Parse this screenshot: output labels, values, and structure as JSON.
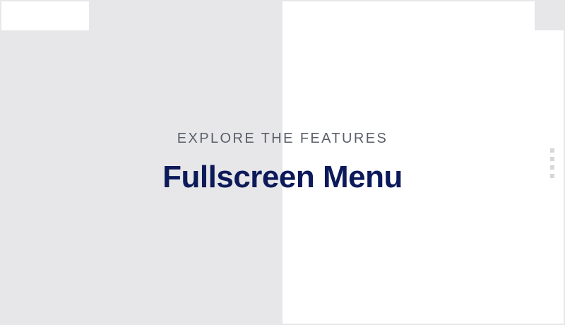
{
  "hero": {
    "eyebrow": "EXPLORE THE FEATURES",
    "headline": "Fullscreen Menu"
  },
  "pager": {
    "icon": "vertical-dots-icon",
    "dot_count": 4
  },
  "colors": {
    "left_panel": "#e7e7e9",
    "right_panel": "#ffffff",
    "eyebrow_text": "#5a5f6b",
    "headline_text": "#0d1a5a",
    "pager_dots": "#d7d7da"
  }
}
